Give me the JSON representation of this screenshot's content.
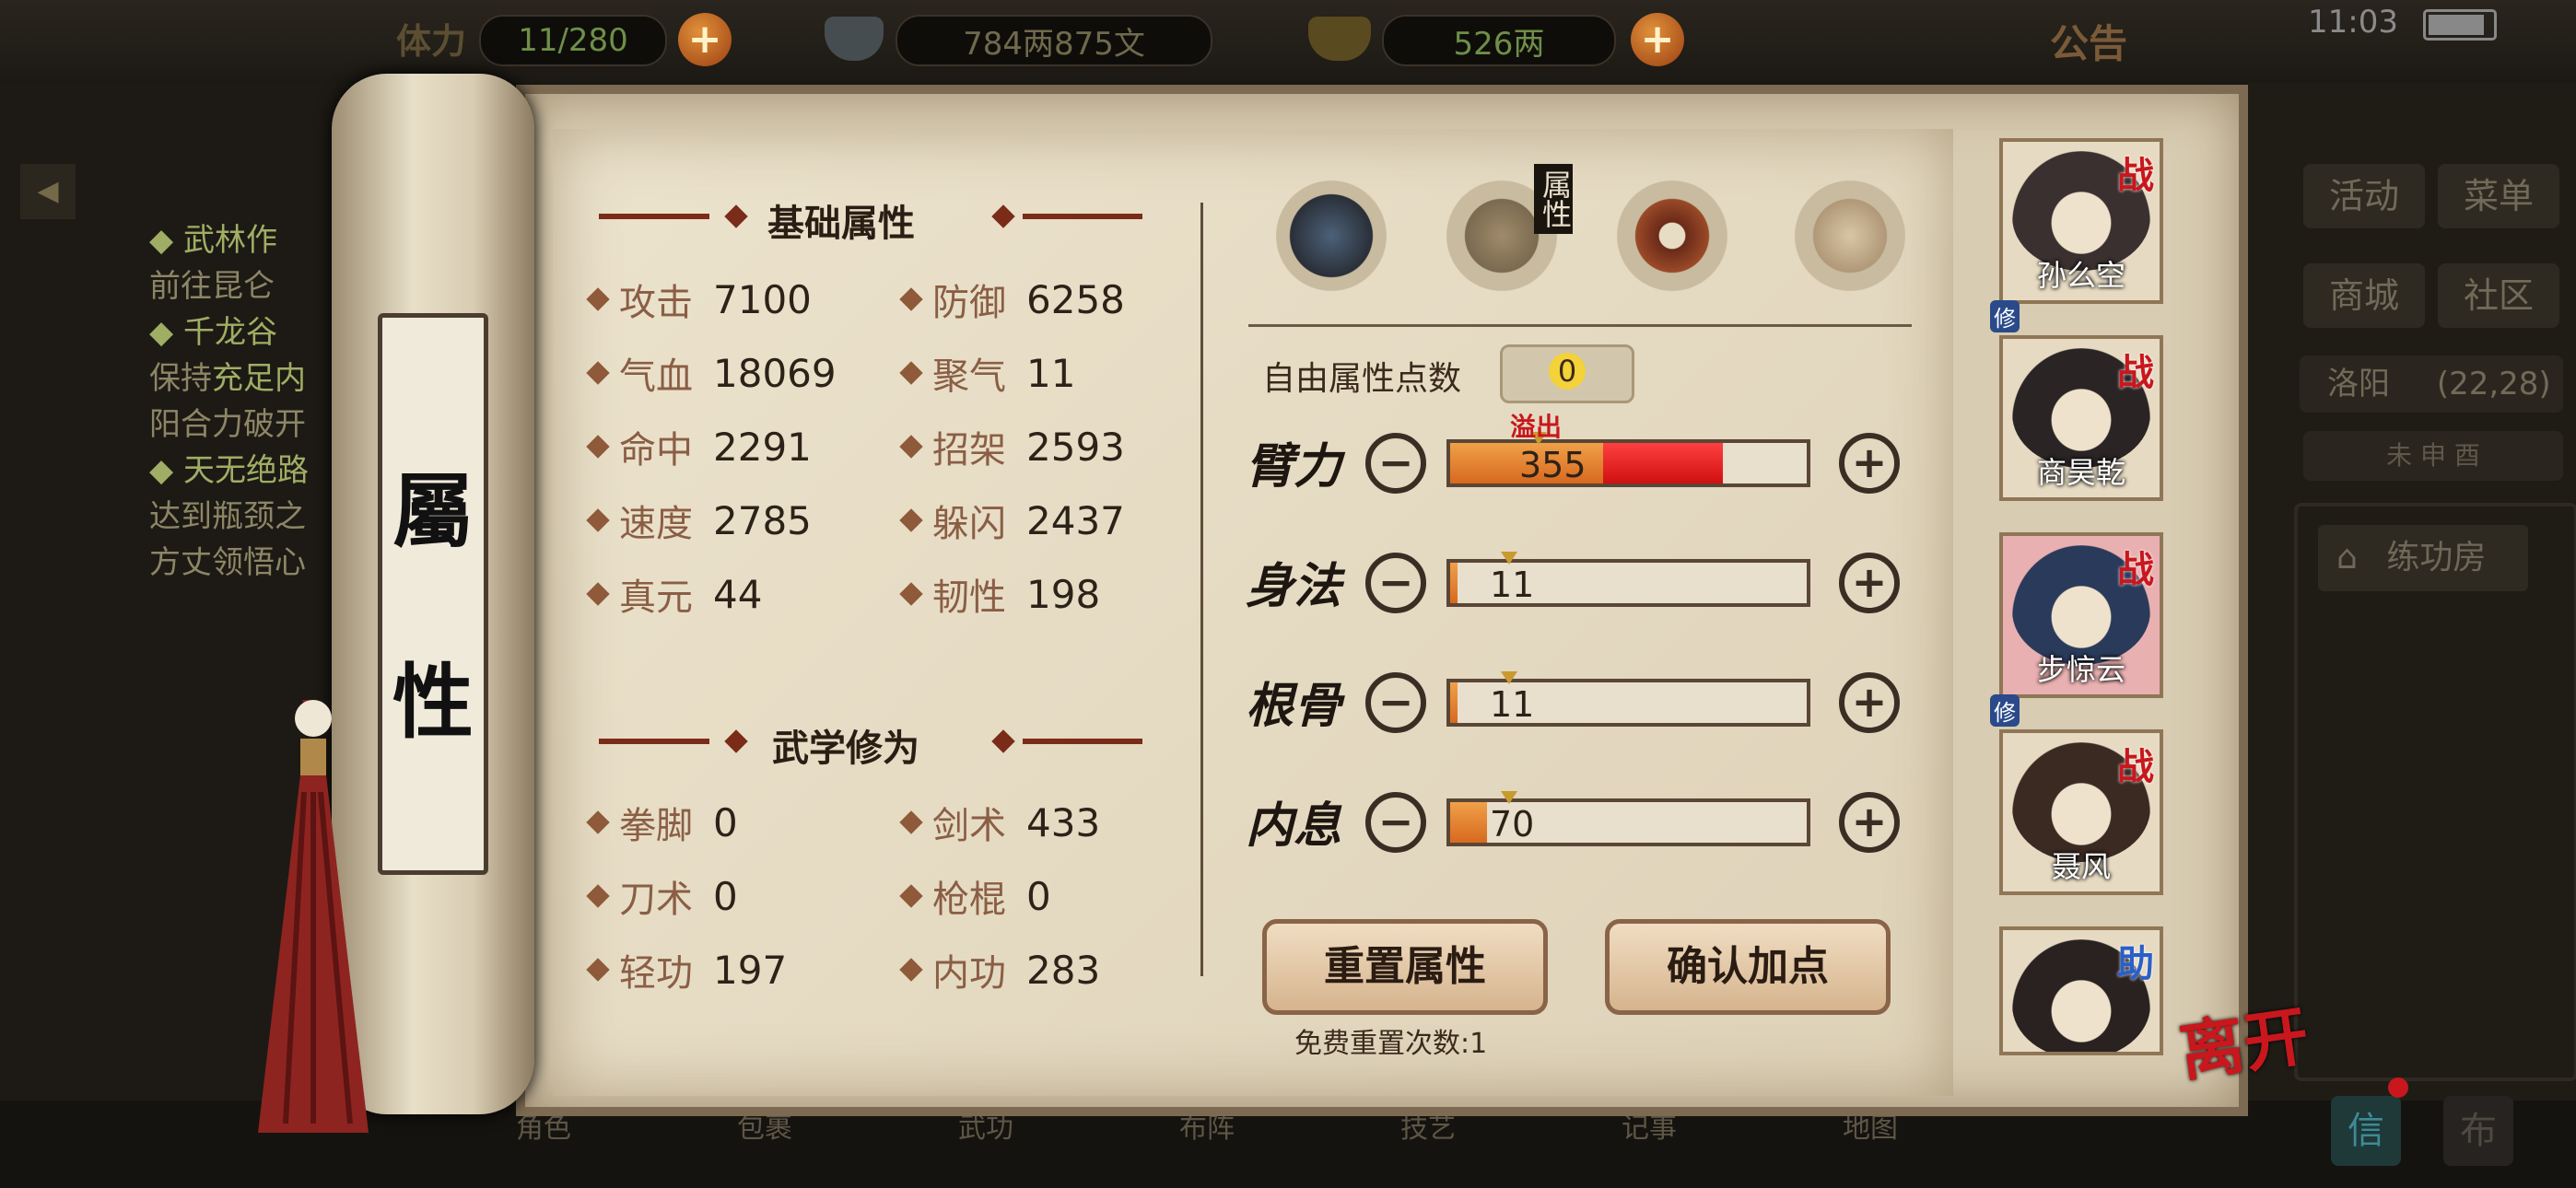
{
  "hud": {
    "stamina_label": "体力",
    "stamina_value": "11/280",
    "silver_value": "784两875文",
    "gold_value": "526两",
    "notice_label": "公告",
    "time": "11:03"
  },
  "quests": {
    "items": [
      {
        "title": "武林作",
        "desc": "前往昆仑"
      },
      {
        "title": "千龙谷",
        "desc_prefix": "保持",
        "desc_highlight": "充足内",
        "desc2": "阳合力破开"
      },
      {
        "title": "天无绝路",
        "desc": "达到瓶颈之",
        "desc2": "方丈领悟心"
      }
    ]
  },
  "scroll_title": {
    "char1": "屬",
    "char2": "性"
  },
  "basic": {
    "title": "基础属性",
    "stats": [
      {
        "label": "攻击",
        "value": "7100"
      },
      {
        "label": "防御",
        "value": "6258"
      },
      {
        "label": "气血",
        "value": "18069"
      },
      {
        "label": "聚气",
        "value": "11"
      },
      {
        "label": "命中",
        "value": "2291"
      },
      {
        "label": "招架",
        "value": "2593"
      },
      {
        "label": "速度",
        "value": "2785"
      },
      {
        "label": "躲闪",
        "value": "2437"
      },
      {
        "label": "真元",
        "value": "44"
      },
      {
        "label": "韧性",
        "value": "198"
      }
    ]
  },
  "martial": {
    "title": "武学修为",
    "stats": [
      {
        "label": "拳脚",
        "value": "0"
      },
      {
        "label": "剑术",
        "value": "433"
      },
      {
        "label": "刀术",
        "value": "0"
      },
      {
        "label": "枪棍",
        "value": "0"
      },
      {
        "label": "轻功",
        "value": "197"
      },
      {
        "label": "内功",
        "value": "283"
      }
    ]
  },
  "tabs": {
    "active_label": "属性",
    "icons": [
      "character-portrait-icon",
      "attribute-scroll-icon",
      "bagua-icon",
      "meridian-body-icon"
    ]
  },
  "free_points": {
    "label": "自由属性点数",
    "value": "0"
  },
  "attributes": [
    {
      "name": "臂力",
      "value": "355",
      "fill": 0.42,
      "overflow_fill": 0.75,
      "overflow_label": "溢出",
      "marker": 0.24
    },
    {
      "name": "身法",
      "value": "11",
      "fill": 0.02,
      "marker": 0.16
    },
    {
      "name": "根骨",
      "value": "11",
      "fill": 0.02,
      "marker": 0.16
    },
    {
      "name": "内息",
      "value": "70",
      "fill": 0.1,
      "marker": 0.16
    }
  ],
  "buttons": {
    "reset": "重置属性",
    "confirm": "确认加点",
    "free_reset": "免费重置次数:1"
  },
  "roster": [
    {
      "name": "孙么空",
      "badge": "战",
      "xiu": "修"
    },
    {
      "name": "商昊乾",
      "badge": "战",
      "xiu": ""
    },
    {
      "name": "步惊云",
      "badge": "战",
      "xiu": "修"
    },
    {
      "name": "聂风",
      "badge": "战",
      "xiu": ""
    },
    {
      "name": "",
      "badge": "助",
      "xiu": ""
    }
  ],
  "leave_label": "离开",
  "right_panel": {
    "activity": "活动",
    "menu": "菜单",
    "mall": "商城",
    "community": "社区",
    "location": "洛阳",
    "coords": "(22,28)",
    "dial": "未 申 酉",
    "practice_room": "练功房",
    "mail": "信",
    "other": "布"
  },
  "bottom_nav": [
    "角色",
    "包裹",
    "武功",
    "布阵",
    "技艺",
    "记事",
    "地图"
  ],
  "colors": {
    "accent_red": "#c8171d",
    "bar_orange": "#d7691e",
    "bar_red": "#e01818",
    "paper": "#ded2b8"
  }
}
